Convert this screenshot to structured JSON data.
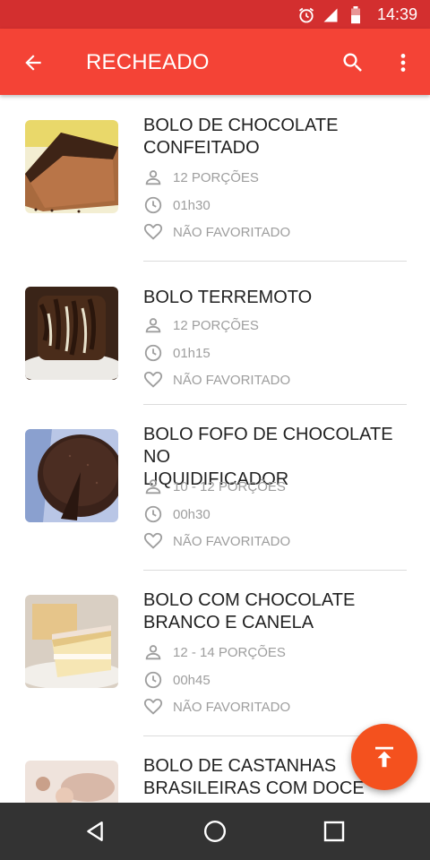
{
  "status_bar": {
    "time": "14:39",
    "icons": [
      "alarm-icon",
      "signal-icon",
      "battery-icon"
    ]
  },
  "app_bar": {
    "title": "RECHEADO",
    "icons": [
      "back-arrow-icon",
      "search-icon",
      "more-vert-icon"
    ]
  },
  "recipes": [
    {
      "title_line1": "BOLO DE CHOCOLATE",
      "title_line2": "CONFEITADO",
      "servings": "12 PORÇÕES",
      "time": "01h30",
      "favorite": "NÃO FAVORITADO"
    },
    {
      "title_line1": "BOLO TERREMOTO",
      "title_line2": "",
      "servings": "12 PORÇÕES",
      "time": "01h15",
      "favorite": "NÃO FAVORITADO"
    },
    {
      "title_line1": "BOLO FOFO DE CHOCOLATE NO",
      "title_line2": "LIQUIDIFICADOR",
      "servings": "10 - 12 PORÇÕES",
      "time": "00h30",
      "favorite": "NÃO FAVORITADO"
    },
    {
      "title_line1": "BOLO COM CHOCOLATE",
      "title_line2": "BRANCO E CANELA",
      "servings": "12 - 14 PORÇÕES",
      "time": "00h45",
      "favorite": "NÃO FAVORITADO"
    },
    {
      "title_line1": "BOLO DE CASTANHAS",
      "title_line2": "BRASILEIRAS COM DOCE",
      "servings": "",
      "time": "",
      "favorite": ""
    }
  ],
  "fab": {
    "icon": "scroll-to-top-icon"
  },
  "nav_bar": {
    "icons": [
      "nav-back-icon",
      "nav-home-icon",
      "nav-recents-icon"
    ]
  },
  "colors": {
    "status_bar": "#d32f2f",
    "app_bar": "#f44336",
    "fab": "#f4511e",
    "nav_bar": "#333333",
    "meta_text": "#9e9e9e"
  }
}
